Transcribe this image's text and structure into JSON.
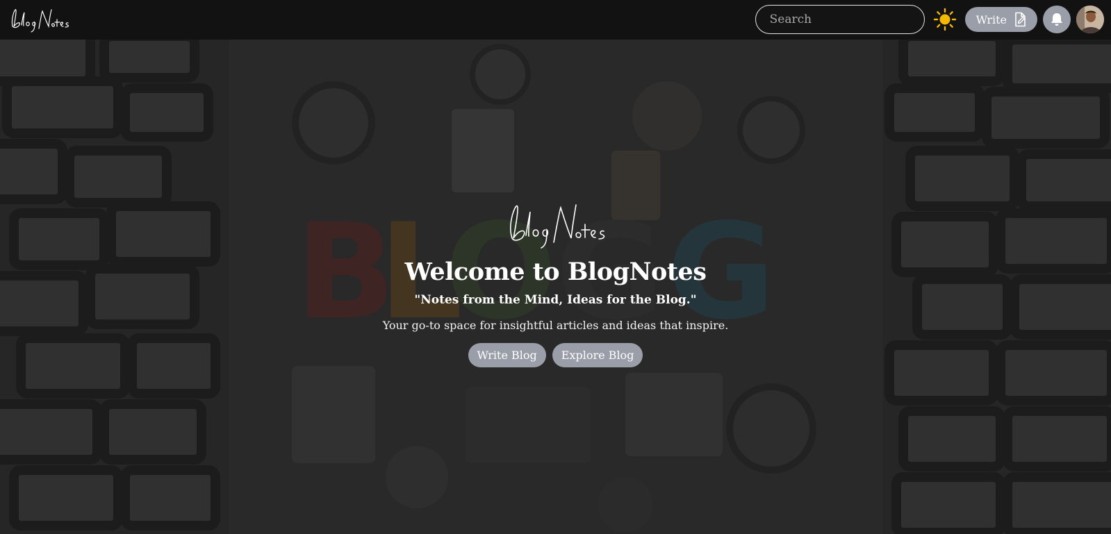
{
  "nav": {
    "logo_text": "BlogNotes",
    "search": {
      "placeholder": "Search",
      "value": ""
    },
    "theme_icon": "sun-icon",
    "write_label": "Write",
    "write_icon": "edit-document-icon",
    "bell_icon": "bell-icon"
  },
  "hero": {
    "logo_text": "BlogNotes",
    "title": "Welcome to BlogNotes",
    "tagline": "\"Notes from the Mind, Ideas for the Blog.\"",
    "description": "Your go-to space for insightful articles and ideas that inspire.",
    "buttons": [
      {
        "label": "Write Blog"
      },
      {
        "label": "Explore Blog"
      }
    ]
  },
  "colors": {
    "nav_bg": "#121212",
    "button_bg": "#9a9ea8",
    "hero_overlay": "#2a2a2a",
    "text": "#ffffff",
    "sun": "#f5b800"
  }
}
